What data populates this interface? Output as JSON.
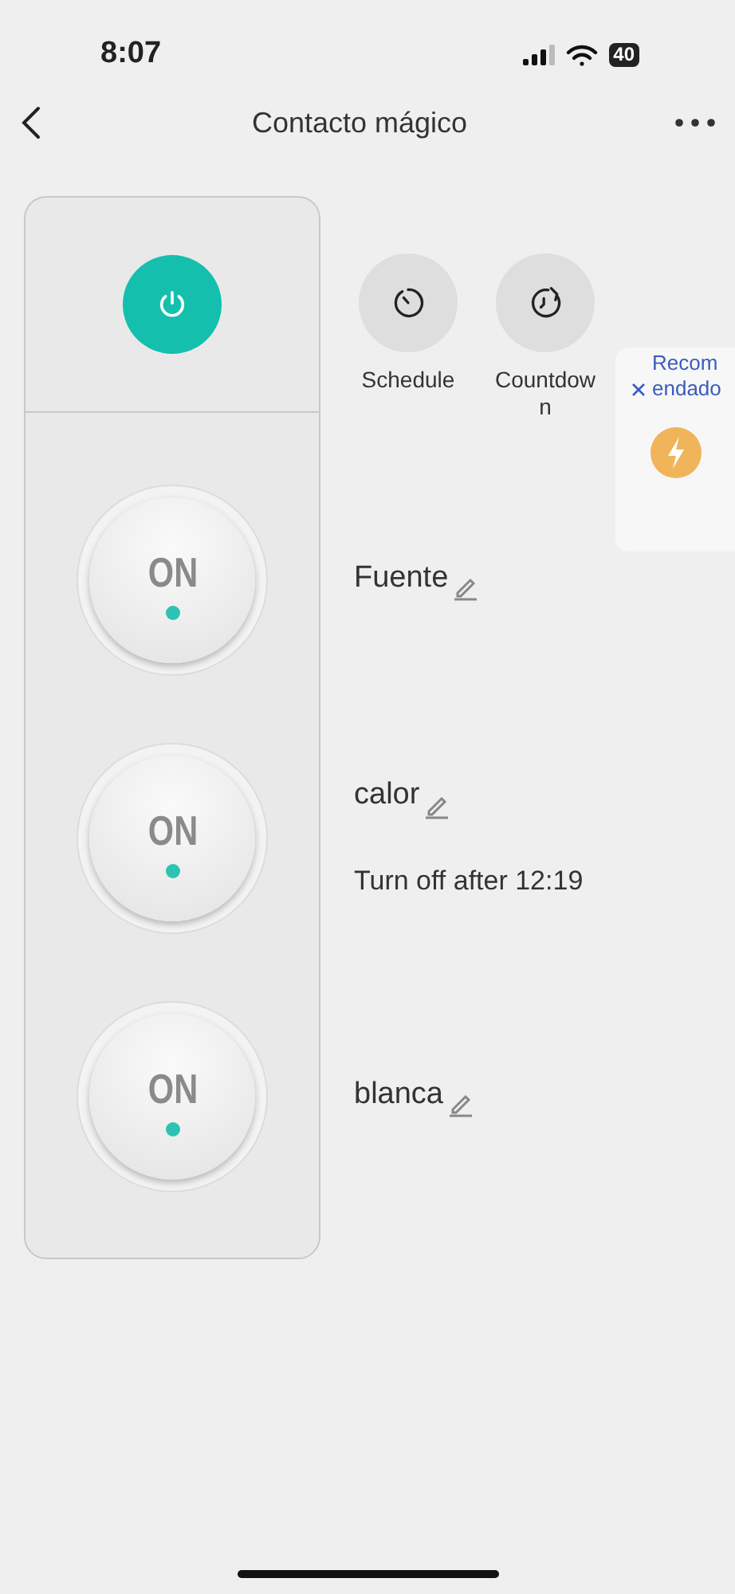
{
  "status_bar": {
    "time": "8:07",
    "battery": "40"
  },
  "header": {
    "title": "Contacto mágico"
  },
  "master_power": {
    "on": true
  },
  "actions": [
    {
      "kind": "schedule",
      "label": "Schedule"
    },
    {
      "kind": "countdown",
      "label": "Countdown"
    }
  ],
  "recommendation": {
    "title": "Recomendado"
  },
  "switches": [
    {
      "label": "ON",
      "name": "Fuente",
      "on": true
    },
    {
      "label": "ON",
      "name": "calor",
      "on": true,
      "timer": "Turn off after 12:19"
    },
    {
      "label": "ON",
      "name": "blanca",
      "on": true
    }
  ]
}
